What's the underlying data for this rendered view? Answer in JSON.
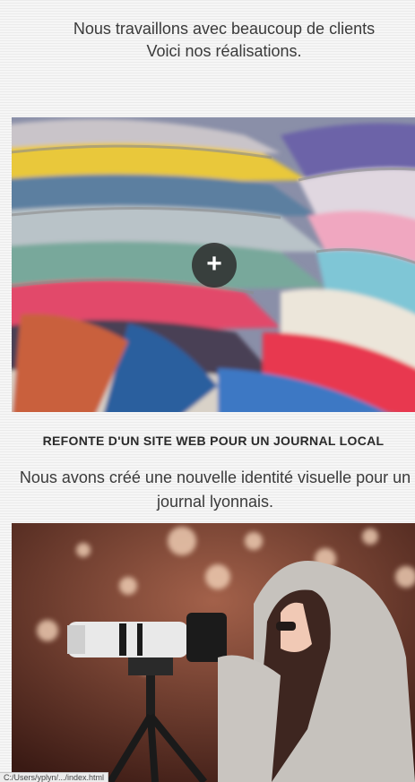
{
  "intro": {
    "line1": "Nous travaillons avec beaucoup de clients",
    "line2": "Voici nos réalisations."
  },
  "projects": [
    {
      "title": "REFONTE D'UN SITE WEB POUR UN JOURNAL LOCAL",
      "description": "Nous avons créé une nouvelle identité visuelle pour un journal lyonnais.",
      "zoom_label": "+",
      "image": "magazines-stack-photo"
    },
    {
      "image": "photographer-camera-photo"
    }
  ],
  "status_bar": {
    "url": "C:/Users/yplyn/.../index.html"
  },
  "colors": {
    "text": "#333333",
    "zoom_button_bg": "#2d2d2d"
  }
}
